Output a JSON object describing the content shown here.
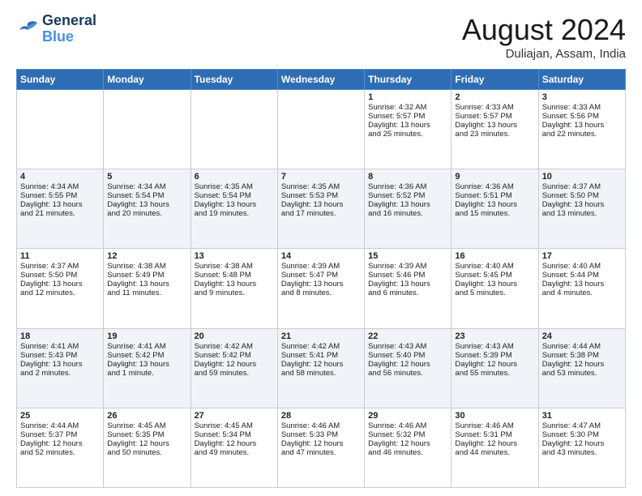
{
  "header": {
    "logo_line1": "General",
    "logo_line2": "Blue",
    "month_title": "August 2024",
    "location": "Duliajan, Assam, India"
  },
  "weekdays": [
    "Sunday",
    "Monday",
    "Tuesday",
    "Wednesday",
    "Thursday",
    "Friday",
    "Saturday"
  ],
  "weeks": [
    [
      {
        "day": "",
        "info": ""
      },
      {
        "day": "",
        "info": ""
      },
      {
        "day": "",
        "info": ""
      },
      {
        "day": "",
        "info": ""
      },
      {
        "day": "1",
        "info": "Sunrise: 4:32 AM\nSunset: 5:57 PM\nDaylight: 13 hours\nand 25 minutes."
      },
      {
        "day": "2",
        "info": "Sunrise: 4:33 AM\nSunset: 5:57 PM\nDaylight: 13 hours\nand 23 minutes."
      },
      {
        "day": "3",
        "info": "Sunrise: 4:33 AM\nSunset: 5:56 PM\nDaylight: 13 hours\nand 22 minutes."
      }
    ],
    [
      {
        "day": "4",
        "info": "Sunrise: 4:34 AM\nSunset: 5:55 PM\nDaylight: 13 hours\nand 21 minutes."
      },
      {
        "day": "5",
        "info": "Sunrise: 4:34 AM\nSunset: 5:54 PM\nDaylight: 13 hours\nand 20 minutes."
      },
      {
        "day": "6",
        "info": "Sunrise: 4:35 AM\nSunset: 5:54 PM\nDaylight: 13 hours\nand 19 minutes."
      },
      {
        "day": "7",
        "info": "Sunrise: 4:35 AM\nSunset: 5:53 PM\nDaylight: 13 hours\nand 17 minutes."
      },
      {
        "day": "8",
        "info": "Sunrise: 4:36 AM\nSunset: 5:52 PM\nDaylight: 13 hours\nand 16 minutes."
      },
      {
        "day": "9",
        "info": "Sunrise: 4:36 AM\nSunset: 5:51 PM\nDaylight: 13 hours\nand 15 minutes."
      },
      {
        "day": "10",
        "info": "Sunrise: 4:37 AM\nSunset: 5:50 PM\nDaylight: 13 hours\nand 13 minutes."
      }
    ],
    [
      {
        "day": "11",
        "info": "Sunrise: 4:37 AM\nSunset: 5:50 PM\nDaylight: 13 hours\nand 12 minutes."
      },
      {
        "day": "12",
        "info": "Sunrise: 4:38 AM\nSunset: 5:49 PM\nDaylight: 13 hours\nand 11 minutes."
      },
      {
        "day": "13",
        "info": "Sunrise: 4:38 AM\nSunset: 5:48 PM\nDaylight: 13 hours\nand 9 minutes."
      },
      {
        "day": "14",
        "info": "Sunrise: 4:39 AM\nSunset: 5:47 PM\nDaylight: 13 hours\nand 8 minutes."
      },
      {
        "day": "15",
        "info": "Sunrise: 4:39 AM\nSunset: 5:46 PM\nDaylight: 13 hours\nand 6 minutes."
      },
      {
        "day": "16",
        "info": "Sunrise: 4:40 AM\nSunset: 5:45 PM\nDaylight: 13 hours\nand 5 minutes."
      },
      {
        "day": "17",
        "info": "Sunrise: 4:40 AM\nSunset: 5:44 PM\nDaylight: 13 hours\nand 4 minutes."
      }
    ],
    [
      {
        "day": "18",
        "info": "Sunrise: 4:41 AM\nSunset: 5:43 PM\nDaylight: 13 hours\nand 2 minutes."
      },
      {
        "day": "19",
        "info": "Sunrise: 4:41 AM\nSunset: 5:42 PM\nDaylight: 13 hours\nand 1 minute."
      },
      {
        "day": "20",
        "info": "Sunrise: 4:42 AM\nSunset: 5:42 PM\nDaylight: 12 hours\nand 59 minutes."
      },
      {
        "day": "21",
        "info": "Sunrise: 4:42 AM\nSunset: 5:41 PM\nDaylight: 12 hours\nand 58 minutes."
      },
      {
        "day": "22",
        "info": "Sunrise: 4:43 AM\nSunset: 5:40 PM\nDaylight: 12 hours\nand 56 minutes."
      },
      {
        "day": "23",
        "info": "Sunrise: 4:43 AM\nSunset: 5:39 PM\nDaylight: 12 hours\nand 55 minutes."
      },
      {
        "day": "24",
        "info": "Sunrise: 4:44 AM\nSunset: 5:38 PM\nDaylight: 12 hours\nand 53 minutes."
      }
    ],
    [
      {
        "day": "25",
        "info": "Sunrise: 4:44 AM\nSunset: 5:37 PM\nDaylight: 12 hours\nand 52 minutes."
      },
      {
        "day": "26",
        "info": "Sunrise: 4:45 AM\nSunset: 5:35 PM\nDaylight: 12 hours\nand 50 minutes."
      },
      {
        "day": "27",
        "info": "Sunrise: 4:45 AM\nSunset: 5:34 PM\nDaylight: 12 hours\nand 49 minutes."
      },
      {
        "day": "28",
        "info": "Sunrise: 4:46 AM\nSunset: 5:33 PM\nDaylight: 12 hours\nand 47 minutes."
      },
      {
        "day": "29",
        "info": "Sunrise: 4:46 AM\nSunset: 5:32 PM\nDaylight: 12 hours\nand 46 minutes."
      },
      {
        "day": "30",
        "info": "Sunrise: 4:46 AM\nSunset: 5:31 PM\nDaylight: 12 hours\nand 44 minutes."
      },
      {
        "day": "31",
        "info": "Sunrise: 4:47 AM\nSunset: 5:30 PM\nDaylight: 12 hours\nand 43 minutes."
      }
    ]
  ]
}
